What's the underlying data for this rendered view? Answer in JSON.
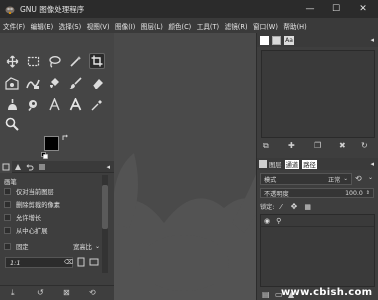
{
  "window": {
    "title": "GNU 图像处理程序",
    "controls": {
      "minimize": "—",
      "maximize": "☐",
      "close": "✕"
    }
  },
  "menu": [
    "文件(F)",
    "编辑(E)",
    "选择(S)",
    "视图(V)",
    "图像(I)",
    "图层(L)",
    "颜色(C)",
    "工具(T)",
    "滤镜(R)",
    "窗口(W)",
    "帮助(H)"
  ],
  "tool_options": {
    "tab_label": "画笔",
    "options": [
      "仅对当前图层",
      "删除剪裁的像素",
      "允许增长",
      "从中心扩展"
    ],
    "fixed_label": "固定",
    "aspect_select": "宽高比",
    "ratio_value": "1:1"
  },
  "layers": {
    "tabs": [
      "图层",
      "通道",
      "路径"
    ],
    "mode_label": "模式",
    "mode_value": "正常",
    "opacity_label": "不透明度",
    "opacity_value": "100.0",
    "lock_label": "锁定:"
  },
  "watermark": "www.cbish.com",
  "colors": {
    "accent": "#d58a00",
    "dark_bg": "#2b2b2b",
    "panel": "#3e3e3e"
  }
}
